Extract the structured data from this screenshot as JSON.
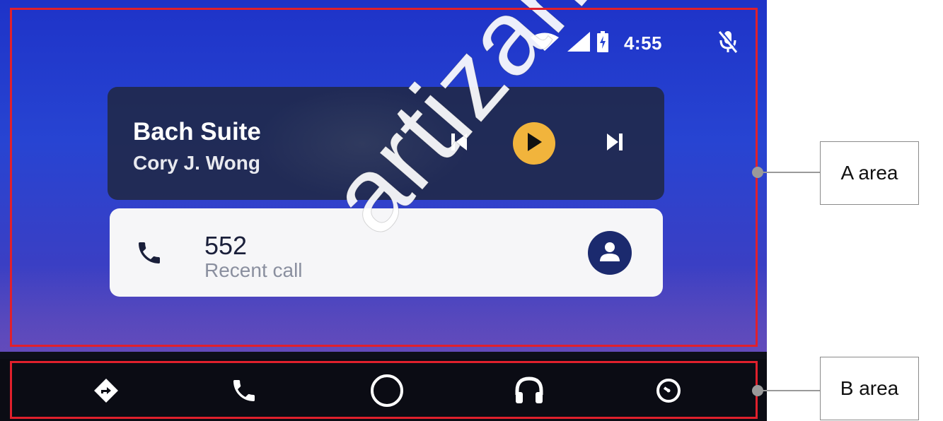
{
  "status_bar": {
    "time": "4:55"
  },
  "media": {
    "title": "Bach Suite",
    "artist": "Cory J. Wong"
  },
  "call": {
    "number": "552",
    "subtitle": "Recent call"
  },
  "annotations": {
    "a_label": "A area",
    "b_label": "B area"
  },
  "watermark": "artizan.com",
  "colors": {
    "play_button": "#f1b43c",
    "avatar": "#1b2a6e",
    "frame": "#e0202c"
  },
  "icons": {
    "status": [
      "wifi-icon",
      "cellular-signal-icon",
      "battery-charging-icon",
      "mic-off-icon"
    ],
    "media": [
      "skip-previous-icon",
      "play-icon",
      "skip-next-icon"
    ],
    "nav": [
      "navigation-icon",
      "phone-icon",
      "home-icon",
      "headphones-icon",
      "exit-icon"
    ]
  }
}
